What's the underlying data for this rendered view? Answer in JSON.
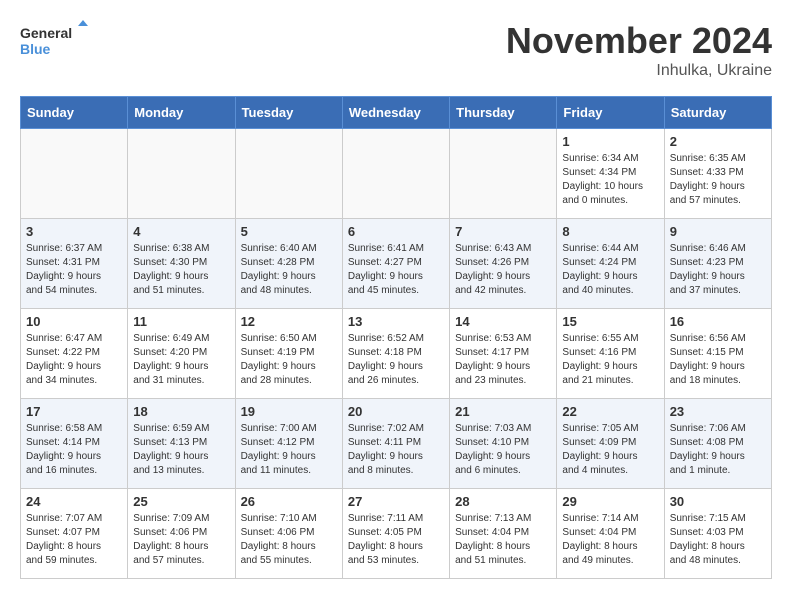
{
  "header": {
    "logo_line1": "General",
    "logo_line2": "Blue",
    "month": "November 2024",
    "location": "Inhulka, Ukraine"
  },
  "weekdays": [
    "Sunday",
    "Monday",
    "Tuesday",
    "Wednesday",
    "Thursday",
    "Friday",
    "Saturday"
  ],
  "weeks": [
    [
      {
        "day": "",
        "info": ""
      },
      {
        "day": "",
        "info": ""
      },
      {
        "day": "",
        "info": ""
      },
      {
        "day": "",
        "info": ""
      },
      {
        "day": "",
        "info": ""
      },
      {
        "day": "1",
        "info": "Sunrise: 6:34 AM\nSunset: 4:34 PM\nDaylight: 10 hours\nand 0 minutes."
      },
      {
        "day": "2",
        "info": "Sunrise: 6:35 AM\nSunset: 4:33 PM\nDaylight: 9 hours\nand 57 minutes."
      }
    ],
    [
      {
        "day": "3",
        "info": "Sunrise: 6:37 AM\nSunset: 4:31 PM\nDaylight: 9 hours\nand 54 minutes."
      },
      {
        "day": "4",
        "info": "Sunrise: 6:38 AM\nSunset: 4:30 PM\nDaylight: 9 hours\nand 51 minutes."
      },
      {
        "day": "5",
        "info": "Sunrise: 6:40 AM\nSunset: 4:28 PM\nDaylight: 9 hours\nand 48 minutes."
      },
      {
        "day": "6",
        "info": "Sunrise: 6:41 AM\nSunset: 4:27 PM\nDaylight: 9 hours\nand 45 minutes."
      },
      {
        "day": "7",
        "info": "Sunrise: 6:43 AM\nSunset: 4:26 PM\nDaylight: 9 hours\nand 42 minutes."
      },
      {
        "day": "8",
        "info": "Sunrise: 6:44 AM\nSunset: 4:24 PM\nDaylight: 9 hours\nand 40 minutes."
      },
      {
        "day": "9",
        "info": "Sunrise: 6:46 AM\nSunset: 4:23 PM\nDaylight: 9 hours\nand 37 minutes."
      }
    ],
    [
      {
        "day": "10",
        "info": "Sunrise: 6:47 AM\nSunset: 4:22 PM\nDaylight: 9 hours\nand 34 minutes."
      },
      {
        "day": "11",
        "info": "Sunrise: 6:49 AM\nSunset: 4:20 PM\nDaylight: 9 hours\nand 31 minutes."
      },
      {
        "day": "12",
        "info": "Sunrise: 6:50 AM\nSunset: 4:19 PM\nDaylight: 9 hours\nand 28 minutes."
      },
      {
        "day": "13",
        "info": "Sunrise: 6:52 AM\nSunset: 4:18 PM\nDaylight: 9 hours\nand 26 minutes."
      },
      {
        "day": "14",
        "info": "Sunrise: 6:53 AM\nSunset: 4:17 PM\nDaylight: 9 hours\nand 23 minutes."
      },
      {
        "day": "15",
        "info": "Sunrise: 6:55 AM\nSunset: 4:16 PM\nDaylight: 9 hours\nand 21 minutes."
      },
      {
        "day": "16",
        "info": "Sunrise: 6:56 AM\nSunset: 4:15 PM\nDaylight: 9 hours\nand 18 minutes."
      }
    ],
    [
      {
        "day": "17",
        "info": "Sunrise: 6:58 AM\nSunset: 4:14 PM\nDaylight: 9 hours\nand 16 minutes."
      },
      {
        "day": "18",
        "info": "Sunrise: 6:59 AM\nSunset: 4:13 PM\nDaylight: 9 hours\nand 13 minutes."
      },
      {
        "day": "19",
        "info": "Sunrise: 7:00 AM\nSunset: 4:12 PM\nDaylight: 9 hours\nand 11 minutes."
      },
      {
        "day": "20",
        "info": "Sunrise: 7:02 AM\nSunset: 4:11 PM\nDaylight: 9 hours\nand 8 minutes."
      },
      {
        "day": "21",
        "info": "Sunrise: 7:03 AM\nSunset: 4:10 PM\nDaylight: 9 hours\nand 6 minutes."
      },
      {
        "day": "22",
        "info": "Sunrise: 7:05 AM\nSunset: 4:09 PM\nDaylight: 9 hours\nand 4 minutes."
      },
      {
        "day": "23",
        "info": "Sunrise: 7:06 AM\nSunset: 4:08 PM\nDaylight: 9 hours\nand 1 minute."
      }
    ],
    [
      {
        "day": "24",
        "info": "Sunrise: 7:07 AM\nSunset: 4:07 PM\nDaylight: 8 hours\nand 59 minutes."
      },
      {
        "day": "25",
        "info": "Sunrise: 7:09 AM\nSunset: 4:06 PM\nDaylight: 8 hours\nand 57 minutes."
      },
      {
        "day": "26",
        "info": "Sunrise: 7:10 AM\nSunset: 4:06 PM\nDaylight: 8 hours\nand 55 minutes."
      },
      {
        "day": "27",
        "info": "Sunrise: 7:11 AM\nSunset: 4:05 PM\nDaylight: 8 hours\nand 53 minutes."
      },
      {
        "day": "28",
        "info": "Sunrise: 7:13 AM\nSunset: 4:04 PM\nDaylight: 8 hours\nand 51 minutes."
      },
      {
        "day": "29",
        "info": "Sunrise: 7:14 AM\nSunset: 4:04 PM\nDaylight: 8 hours\nand 49 minutes."
      },
      {
        "day": "30",
        "info": "Sunrise: 7:15 AM\nSunset: 4:03 PM\nDaylight: 8 hours\nand 48 minutes."
      }
    ]
  ]
}
